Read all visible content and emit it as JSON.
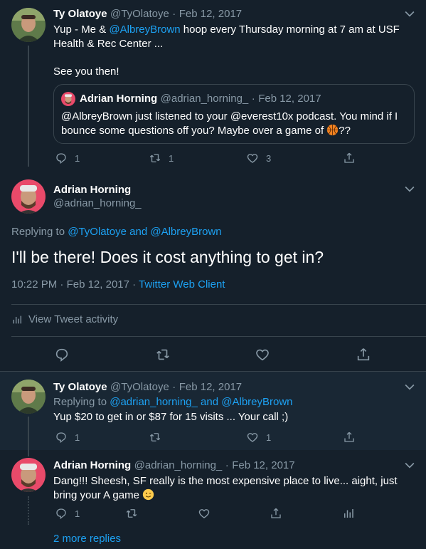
{
  "tweet1": {
    "name": "Ty Olatoye",
    "handle": "@TyOlatoye",
    "sep": "·",
    "date": "Feb 12, 2017",
    "line1_prefix": "Yup - Me & ",
    "line1_mention": "@AlbreyBrown",
    "line1_suffix": " hoop every Thursday morning at 7 am at USF",
    "line2": "Health & Rec Center ...",
    "line3": "See you then!",
    "quote": {
      "name": "Adrian Horning",
      "handle": "@adrian_horning_",
      "sep": "·",
      "date": "Feb 12, 2017",
      "line1": "@AlbreyBrown just listened to your @everest10x podcast. You mind if I",
      "line2_prefix": "bounce some questions off you? Maybe over a game of ",
      "line2_suffix": "??"
    },
    "reply_count": "1",
    "retweet_count": "1",
    "like_count": "3"
  },
  "main": {
    "name": "Adrian Horning",
    "handle": "@adrian_horning_",
    "replying_prefix": "Replying to ",
    "replying_user1": "@TyOlatoye",
    "replying_and": " and ",
    "replying_user2": "@AlbreyBrown",
    "text": "I'll be there! Does it cost anything to get in?",
    "time": "10:22 PM",
    "sep": " · ",
    "date": "Feb 12, 2017",
    "sep2": " · ",
    "client": "Twitter Web Client",
    "activity_label": "View Tweet activity"
  },
  "reply1": {
    "name": "Ty Olatoye",
    "handle": "@TyOlatoye",
    "sep": "·",
    "date": "Feb 12, 2017",
    "replying_prefix": "Replying to ",
    "replying_user1": "@adrian_horning_",
    "replying_and": " and ",
    "replying_user2": "@AlbreyBrown",
    "text": "Yup $20 to get in or $87 for 15 visits ... Your call ;)",
    "reply_count": "1",
    "like_count": "1"
  },
  "reply2": {
    "name": "Adrian Horning",
    "handle": "@adrian_horning_",
    "sep": "·",
    "date": "Feb 12, 2017",
    "line1": "Dang!!! Sheesh, SF really is the most expensive place to live... aight, just",
    "line2": "bring your A game ",
    "reply_count": "1"
  },
  "more_replies": "2 more replies",
  "colors": {
    "background": "#15202b",
    "reply_background": "#192734",
    "border": "#38444d",
    "secondary_text": "#8899a6",
    "accent": "#1da1f2"
  }
}
